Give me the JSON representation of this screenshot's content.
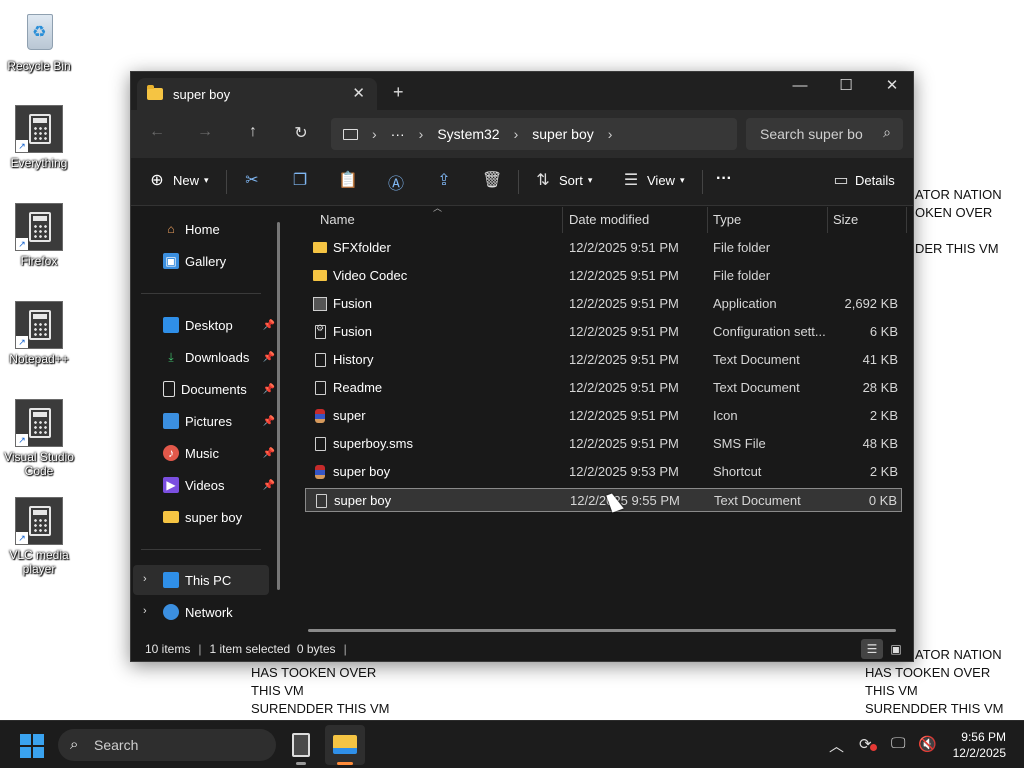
{
  "desktop": {
    "icons": [
      {
        "label": "Recycle Bin"
      },
      {
        "label": "Everything"
      },
      {
        "label": "Firefox"
      },
      {
        "label": "Notepad++"
      },
      {
        "label": "Visual Studio Code"
      },
      {
        "label": "VLC media player"
      }
    ],
    "overlay_right_top": [
      "ATOR NATION",
      "OKEN OVER",
      "",
      "DER THIS VM"
    ],
    "overlay_left_bottom": [
      "HAS TOOKEN OVER",
      "THIS VM",
      "SURENDDER THIS VM"
    ],
    "overlay_right_bottom": [
      "ATOR NATION",
      "HAS TOOKEN OVER",
      "THIS VM",
      "SURENDDER THIS VM"
    ]
  },
  "window": {
    "tab_title": "super boy",
    "tab_close": "✕",
    "new_tab": "+",
    "controls": {
      "minimize": "—",
      "maximize": "☐",
      "close": "✕"
    },
    "nav": {
      "back": "←",
      "forward": "→",
      "up": "↑",
      "refresh": "↻"
    },
    "breadcrumb": {
      "more": "···",
      "items": [
        "System32",
        "super boy"
      ]
    },
    "search_placeholder": "Search super bo",
    "toolbar": {
      "new_label": "New",
      "sort_label": "Sort",
      "view_label": "View",
      "more": "···",
      "details_label": "Details"
    },
    "sidebar": {
      "home": "Home",
      "gallery": "Gallery",
      "pinned": [
        "Desktop",
        "Downloads",
        "Documents",
        "Pictures",
        "Music",
        "Videos"
      ],
      "recent_folder": "super boy",
      "this_pc": "This PC",
      "network": "Network"
    },
    "columns": {
      "name": "Name",
      "date": "Date modified",
      "type": "Type",
      "size": "Size"
    },
    "files": [
      {
        "name": "SFXfolder",
        "date": "12/2/2025 9:51 PM",
        "type": "File folder",
        "size": "",
        "icon": "folder"
      },
      {
        "name": "Video Codec",
        "date": "12/2/2025 9:51 PM",
        "type": "File folder",
        "size": "",
        "icon": "folder"
      },
      {
        "name": "Fusion",
        "date": "12/2/2025 9:51 PM",
        "type": "Application",
        "size": "2,692 KB",
        "icon": "app"
      },
      {
        "name": "Fusion",
        "date": "12/2/2025 9:51 PM",
        "type": "Configuration sett...",
        "size": "6 KB",
        "icon": "cfg"
      },
      {
        "name": "History",
        "date": "12/2/2025 9:51 PM",
        "type": "Text Document",
        "size": "41 KB",
        "icon": "doc"
      },
      {
        "name": "Readme",
        "date": "12/2/2025 9:51 PM",
        "type": "Text Document",
        "size": "28 KB",
        "icon": "doc"
      },
      {
        "name": "super",
        "date": "12/2/2025 9:51 PM",
        "type": "Icon",
        "size": "2 KB",
        "icon": "sprite"
      },
      {
        "name": "superboy.sms",
        "date": "12/2/2025 9:51 PM",
        "type": "SMS File",
        "size": "48 KB",
        "icon": "doc"
      },
      {
        "name": "super boy",
        "date": "12/2/2025 9:53 PM",
        "type": "Shortcut",
        "size": "2 KB",
        "icon": "sprite"
      },
      {
        "name": "super boy",
        "date": "12/2/2025 9:55 PM",
        "type": "Text Document",
        "size": "0 KB",
        "icon": "doc",
        "selected": true
      }
    ],
    "status": {
      "count": "10 items",
      "selection": "1 item selected  0 bytes"
    }
  },
  "taskbar": {
    "search_label": "Search",
    "time": "9:56 PM",
    "date": "12/2/2025"
  },
  "colors": {
    "accent": "#3aa3f0",
    "window_bg": "#191919",
    "selection": "#353535"
  }
}
